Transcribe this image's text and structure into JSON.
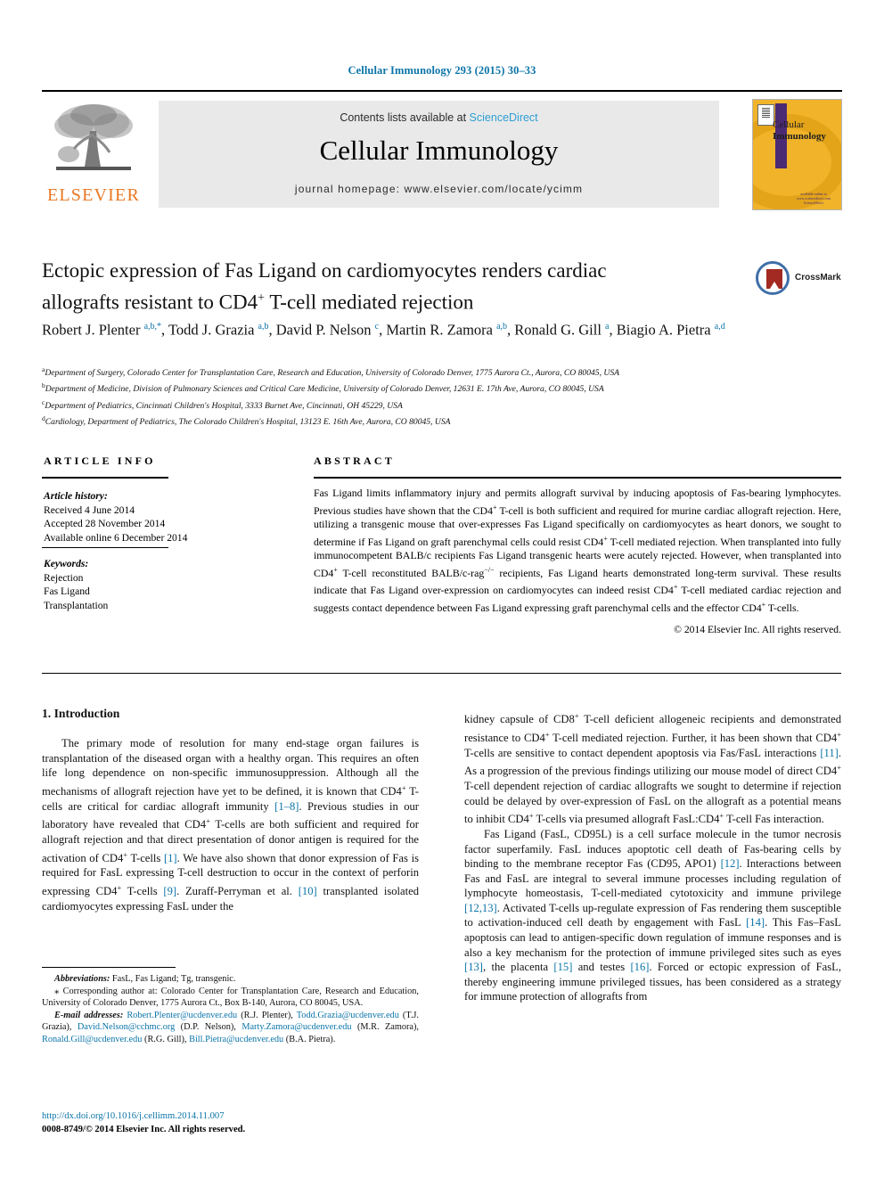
{
  "running_head": "Cellular Immunology 293 (2015) 30–33",
  "masthead": {
    "contents_prefix": "Contents lists available at ",
    "sciencedirect": "ScienceDirect",
    "journal_title": "Cellular Immunology",
    "homepage": "journal homepage: www.elsevier.com/locate/ycimm",
    "publisher_logo_text": "ELSEVIER",
    "cover_title_line1": "Cellular",
    "cover_title_line2": "Immunology",
    "cover_footer": "available online at www.sciencedirect.com\nScienceDirect",
    "accent_color": "#2e9fd4",
    "publisher_color": "#e87722",
    "cover_color": "#f0b32a",
    "cover_accent_color": "#4b2a74"
  },
  "article": {
    "title_line1": "Ectopic expression of Fas Ligand on cardiomyocytes renders cardiac",
    "title_line2_pre": "allografts resistant to CD4",
    "title_line2_sup": "+",
    "title_line2_post": " T-cell mediated rejection",
    "crossmark_label": "CrossMark",
    "authors_html": "Robert J. Plenter <sup>a,b,</sup><sup>*</sup>, Todd J. Grazia <sup>a,b</sup>, David P. Nelson <sup>c</sup>, Martin R. Zamora <sup>a,b</sup>, Ronald G. Gill <sup>a</sup>, Biagio A. Pietra <sup>a,d</sup>",
    "affiliations": [
      {
        "marker": "a",
        "text": "Department of Surgery, Colorado Center for Transplantation Care, Research and Education, University of Colorado Denver, 1775 Aurora Ct., Aurora, CO 80045, USA"
      },
      {
        "marker": "b",
        "text": "Department of Medicine, Division of Pulmonary Sciences and Critical Care Medicine, University of Colorado Denver, 12631 E. 17th Ave, Aurora, CO 80045, USA"
      },
      {
        "marker": "c",
        "text": "Department of Pediatrics, Cincinnati Children's Hospital, 3333 Burnet Ave, Cincinnati, OH 45229, USA"
      },
      {
        "marker": "d",
        "text": "Cardiology, Department of Pediatrics, The Colorado Children's Hospital, 13123 E. 16th Ave, Aurora, CO 80045, USA"
      }
    ]
  },
  "article_info": {
    "label": "ARTICLE INFO",
    "history_heading": "Article history:",
    "history": [
      "Received 4 June 2014",
      "Accepted 28 November 2014",
      "Available online 6 December 2014"
    ],
    "keywords_heading": "Keywords:",
    "keywords": [
      "Rejection",
      "Fas Ligand",
      "Transplantation"
    ]
  },
  "abstract": {
    "label": "ABSTRACT",
    "text_html": "Fas Ligand limits inflammatory injury and permits allograft survival by inducing apoptosis of Fas-bearing lymphocytes. Previous studies have shown that the CD4<sup>+</sup> T-cell is both sufficient and required for murine cardiac allograft rejection. Here, utilizing a transgenic mouse that over-expresses Fas Ligand specifically on cardiomyocytes as heart donors, we sought to determine if Fas Ligand on graft parenchymal cells could resist CD4<sup>+</sup> T-cell mediated rejection. When transplanted into fully immunocompetent BALB/c recipients Fas Ligand transgenic hearts were acutely rejected. However, when transplanted into CD4<sup>+</sup> T-cell reconstituted BALB/c-rag<sup>−/−</sup> recipients, Fas Ligand hearts demonstrated long-term survival. These results indicate that Fas Ligand over-expression on cardiomyocytes can indeed resist CD4<sup>+</sup> T-cell mediated cardiac rejection and suggests contact dependence between Fas Ligand expressing graft parenchymal cells and the effector CD4<sup>+</sup> T-cells.",
    "copyright": "© 2014 Elsevier Inc. All rights reserved."
  },
  "body": {
    "section_heading": "1. Introduction",
    "left_paragraphs_html": [
      "The primary mode of resolution for many end-stage organ failures is transplantation of the diseased organ with a healthy organ. This requires an often life long dependence on non-specific immunosuppression. Although all the mechanisms of allograft rejection have yet to be defined, it is known that CD4<sup>+</sup> T-cells are critical for cardiac allograft immunity <span class=\"ref\">[1–8]</span>. Previous studies in our laboratory have revealed that CD4<sup>+</sup> T-cells are both sufficient and required for allograft rejection and that direct presentation of donor antigen is required for the activation of CD4<sup>+</sup> T-cells <span class=\"ref\">[1]</span>. We have also shown that donor expression of Fas is required for FasL expressing T-cell destruction to occur in the context of perforin expressing CD4<sup>+</sup> T-cells <span class=\"ref\">[9]</span>. Zuraff-Perryman et al. <span class=\"ref\">[10]</span> transplanted isolated cardiomyocytes expressing FasL under the"
    ],
    "right_paragraphs_html": [
      "kidney capsule of CD8<sup>+</sup> T-cell deficient allogeneic recipients and demonstrated resistance to CD4<sup>+</sup> T-cell mediated rejection. Further, it has been shown that CD4<sup>+</sup> T-cells are sensitive to contact dependent apoptosis via Fas/FasL interactions <span class=\"ref\">[11]</span>. As a progression of the previous findings utilizing our mouse model of direct CD4<sup>+</sup> T-cell dependent rejection of cardiac allografts we sought to determine if rejection could be delayed by over-expression of FasL on the allograft as a potential means to inhibit CD4<sup>+</sup> T-cells via presumed allograft FasL:CD4<sup>+</sup> T-cell Fas interaction.",
      "Fas Ligand (FasL, CD95L) is a cell surface molecule in the tumor necrosis factor superfamily. FasL induces apoptotic cell death of Fas-bearing cells by binding to the membrane receptor Fas (CD95, APO1) <span class=\"ref\">[12]</span>. Interactions between Fas and FasL are integral to several immune processes including regulation of lymphocyte homeostasis, T-cell-mediated cytotoxicity and immune privilege <span class=\"ref\">[12,13]</span>. Activated T-cells up-regulate expression of Fas rendering them susceptible to activation-induced cell death by engagement with FasL <span class=\"ref\">[14]</span>. This Fas–FasL apoptosis can lead to antigen-specific down regulation of immune responses and is also a key mechanism for the protection of immune privileged sites such as eyes <span class=\"ref\">[13]</span>, the placenta <span class=\"ref\">[15]</span> and testes <span class=\"ref\">[16]</span>. Forced or ectopic expression of FasL, thereby engineering immune privileged tissues, has been considered as a strategy for immune protection of allografts from"
    ]
  },
  "footnotes": {
    "abbreviations_html": "<span class=\"em\">Abbreviations:</span> FasL, Fas Ligand; Tg, transgenic.",
    "corresponding_html": "<span style=\"font-size:11px\">⁎</span> Corresponding author at: Colorado Center for Transplantation Care, Research and Education, University of Colorado Denver, 1775 Aurora Ct., Box B-140, Aurora, CO 80045, USA.",
    "emails_html": "<span class=\"em\">E-mail addresses:</span> <span class=\"link\">Robert.Plenter@ucdenver.edu</span> (R.J. Plenter), <span class=\"link\">Todd.Grazia@ucdenver.edu</span> (T.J. Grazia), <span class=\"link\">David.Nelson@cchmc.org</span> (D.P. Nelson), <span class=\"link\">Marty.Zamora@ucdenver.edu</span> (M.R. Zamora), <span class=\"link\">Ronald.Gill@ucdenver.edu</span> (R.G. Gill), <span class=\"link\">Bill.Pietra@ucdenver.edu</span> (B.A. Pietra)."
  },
  "doi_block": {
    "doi": "http://dx.doi.org/10.1016/j.cellimm.2014.11.007",
    "issn_line": "0008-8749/© 2014 Elsevier Inc. All rights reserved."
  }
}
